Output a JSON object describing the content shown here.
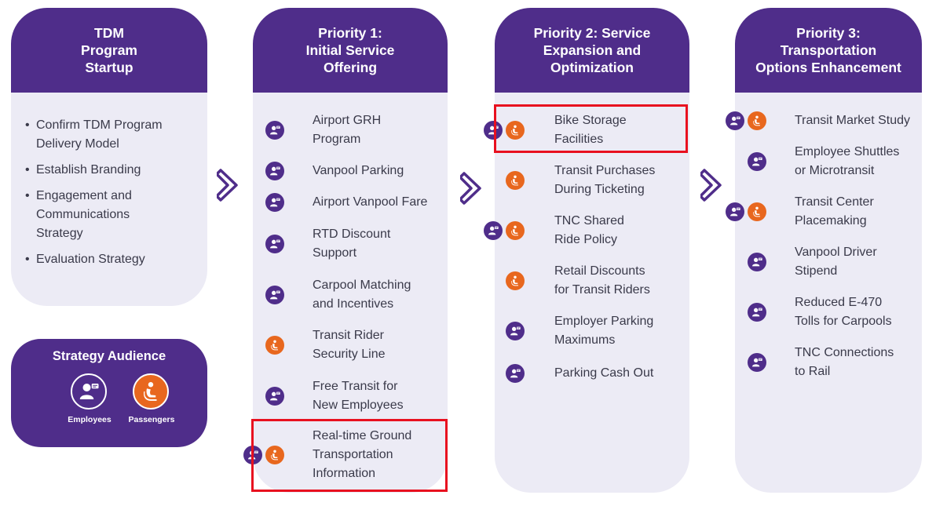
{
  "colors": {
    "purple": "#4f2d8a",
    "orange": "#e8671e",
    "panel": "#ecebf5",
    "highlight": "#e8101f"
  },
  "startup": {
    "title_lines": [
      "TDM",
      "Program",
      "Startup"
    ],
    "bullets": [
      [
        "Confirm TDM Program",
        "Delivery Model"
      ],
      [
        "Establish Branding"
      ],
      [
        "Engagement and",
        "Communications",
        "Strategy"
      ],
      [
        "Evaluation Strategy"
      ]
    ]
  },
  "legend": {
    "title": "Strategy Audience",
    "employees": "Employees",
    "passengers": "Passengers",
    "employees_icon": "employee-icon",
    "passengers_icon": "passenger-icon"
  },
  "priority1": {
    "title_lines": [
      "Priority 1:",
      "Initial Service",
      "Offering"
    ],
    "items": [
      {
        "lines": [
          "Airport GRH",
          "Program"
        ],
        "audience": [
          "employees"
        ]
      },
      {
        "lines": [
          "Vanpool Parking"
        ],
        "audience": [
          "employees"
        ]
      },
      {
        "lines": [
          "Airport Vanpool Fare"
        ],
        "audience": [
          "employees"
        ]
      },
      {
        "lines": [
          "RTD Discount",
          "Support"
        ],
        "audience": [
          "employees"
        ]
      },
      {
        "lines": [
          "Carpool Matching",
          "and Incentives"
        ],
        "audience": [
          "employees"
        ]
      },
      {
        "lines": [
          "Transit Rider",
          "Security Line"
        ],
        "audience": [
          "passengers"
        ]
      },
      {
        "lines": [
          "Free Transit for",
          "New Employees"
        ],
        "audience": [
          "employees"
        ]
      },
      {
        "lines": [
          "Real-time Ground",
          "Transportation",
          "Information"
        ],
        "audience": [
          "employees",
          "passengers"
        ],
        "highlighted": true
      }
    ]
  },
  "priority2": {
    "title_lines": [
      "Priority 2: Service",
      "Expansion and",
      "Optimization"
    ],
    "items": [
      {
        "lines": [
          "Bike Storage",
          "Facilities"
        ],
        "audience": [
          "employees",
          "passengers"
        ],
        "highlighted": true
      },
      {
        "lines": [
          "Transit Purchases",
          "During Ticketing"
        ],
        "audience": [
          "passengers"
        ]
      },
      {
        "lines": [
          "TNC Shared",
          "Ride Policy"
        ],
        "audience": [
          "employees",
          "passengers"
        ]
      },
      {
        "lines": [
          "Retail Discounts",
          "for Transit Riders"
        ],
        "audience": [
          "passengers"
        ]
      },
      {
        "lines": [
          "Employer Parking",
          "Maximums"
        ],
        "audience": [
          "employees"
        ]
      },
      {
        "lines": [
          "Parking Cash Out"
        ],
        "audience": [
          "employees"
        ]
      }
    ]
  },
  "priority3": {
    "title_lines": [
      "Priority 3:",
      "Transportation",
      "Options Enhancement"
    ],
    "items": [
      {
        "lines": [
          "Transit Market Study"
        ],
        "audience": [
          "employees",
          "passengers"
        ]
      },
      {
        "lines": [
          "Employee Shuttles",
          "or Microtransit"
        ],
        "audience": [
          "employees"
        ]
      },
      {
        "lines": [
          "Transit Center",
          "Placemaking"
        ],
        "audience": [
          "employees",
          "passengers"
        ]
      },
      {
        "lines": [
          "Vanpool Driver",
          "Stipend"
        ],
        "audience": [
          "employees"
        ]
      },
      {
        "lines": [
          "Reduced E-470",
          "Tolls for Carpools"
        ],
        "audience": [
          "employees"
        ]
      },
      {
        "lines": [
          "TNC Connections",
          "to Rail"
        ],
        "audience": [
          "employees"
        ]
      }
    ]
  }
}
